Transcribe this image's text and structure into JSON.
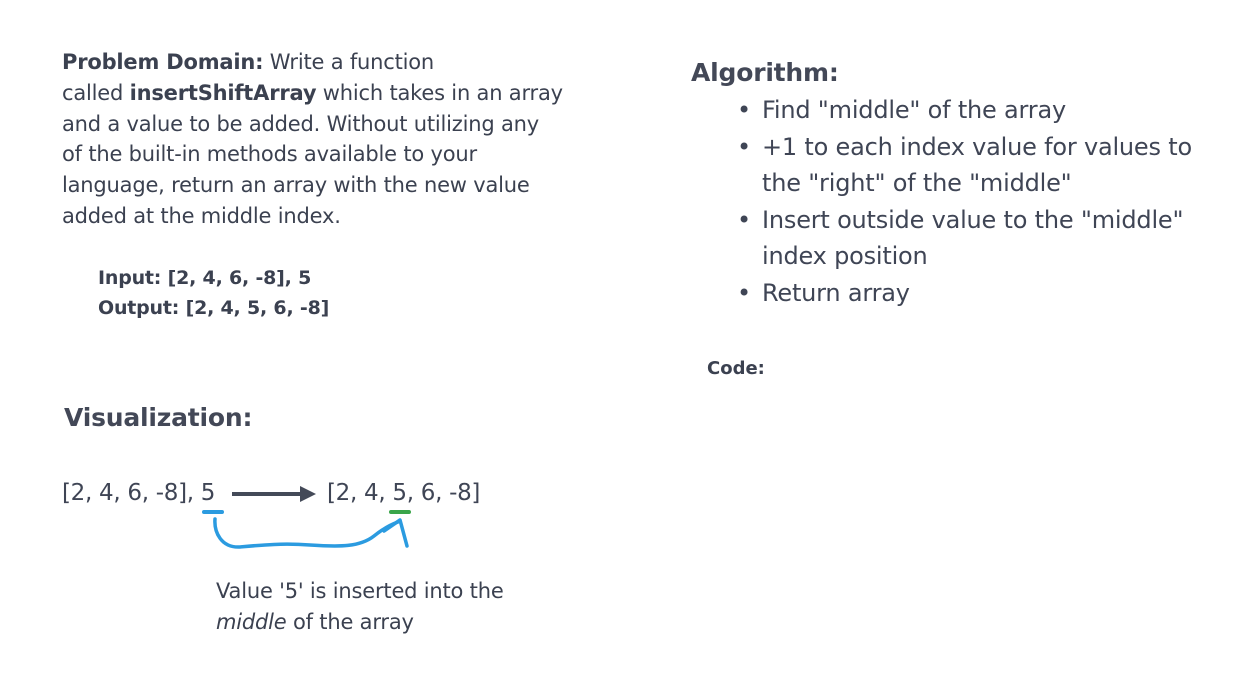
{
  "problem": {
    "label": "Problem Domain:",
    "text_1": " Write a function",
    "text_2a": "called ",
    "function_name": "insertShiftArray",
    "text_2b": " which takes in an array",
    "text_3": "and a value to be added. Without utilizing any",
    "text_4": "of the built-in methods available to your",
    "text_5": "language, return an array with the new value",
    "text_6": "added at the middle index.",
    "input": "Input: [2, 4, 6, -8], 5",
    "output": "Output: [2, 4, 5, 6, -8]"
  },
  "visualization": {
    "title": "Visualization:",
    "input_expr": "[2, 4, 6, -8], 5",
    "output_expr": "[2, 4, 5, 6, -8]",
    "caption_1": "Value '5' is inserted into the",
    "caption_2_em": "middle",
    "caption_2_rest": " of the array",
    "colors": {
      "source_underline": "#2b9be0",
      "target_underline": "#3aa54a",
      "curve": "#2b9be0",
      "arrow": "#444a58"
    }
  },
  "algorithm": {
    "title": "Algorithm:",
    "items": [
      "Find \"middle\" of the array",
      "+1 to each index value for values to the \"right\" of the \"middle\"",
      "Insert outside value to the \"middle\" index position",
      "Return array"
    ]
  },
  "code": {
    "label": "Code:"
  }
}
